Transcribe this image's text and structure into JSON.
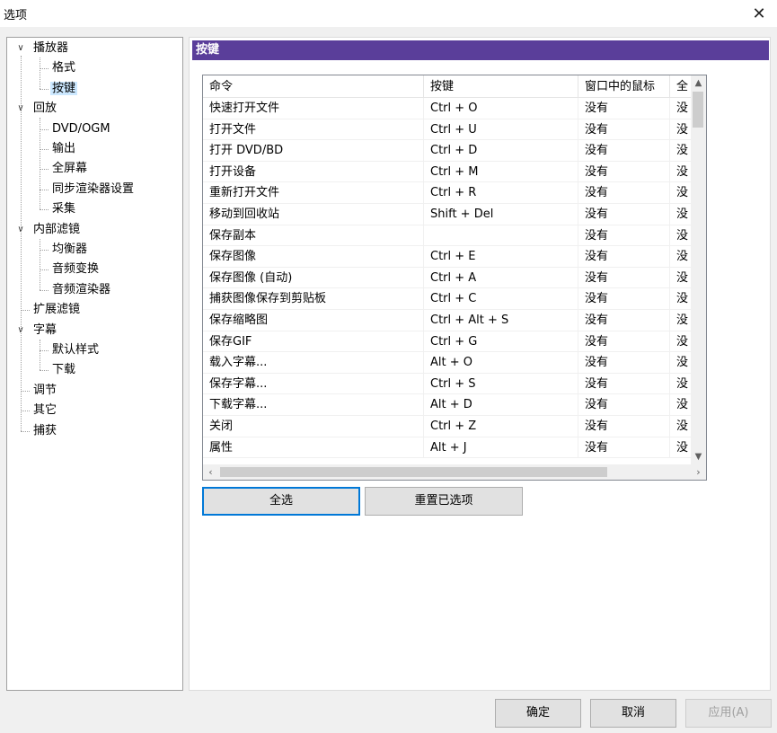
{
  "window": {
    "title": "选项",
    "close_glyph": "✕"
  },
  "tree": {
    "items": [
      {
        "label": "播放器",
        "level": 0,
        "expanded": true
      },
      {
        "label": "格式",
        "level": 1
      },
      {
        "label": "按键",
        "level": 1,
        "selected": true
      },
      {
        "label": "回放",
        "level": 0,
        "expanded": true
      },
      {
        "label": "DVD/OGM",
        "level": 1
      },
      {
        "label": "输出",
        "level": 1
      },
      {
        "label": "全屏幕",
        "level": 1
      },
      {
        "label": "同步渲染器设置",
        "level": 1
      },
      {
        "label": "采集",
        "level": 1
      },
      {
        "label": "内部滤镜",
        "level": 0,
        "expanded": true
      },
      {
        "label": "均衡器",
        "level": 1
      },
      {
        "label": "音频变换",
        "level": 1
      },
      {
        "label": "音频渲染器",
        "level": 1
      },
      {
        "label": "扩展滤镜",
        "level": 0
      },
      {
        "label": "字幕",
        "level": 0,
        "expanded": true
      },
      {
        "label": "默认样式",
        "level": 1
      },
      {
        "label": "下载",
        "level": 1
      },
      {
        "label": "调节",
        "level": 0
      },
      {
        "label": "其它",
        "level": 0
      },
      {
        "label": "捕获",
        "level": 0
      }
    ]
  },
  "panel": {
    "header": "按键",
    "columns": [
      "命令",
      "按键",
      "窗口中的鼠标",
      "全"
    ],
    "rows": [
      [
        "快速打开文件",
        "Ctrl + O",
        "没有",
        "没"
      ],
      [
        "打开文件",
        "Ctrl + U",
        "没有",
        "没"
      ],
      [
        "打开 DVD/BD",
        "Ctrl + D",
        "没有",
        "没"
      ],
      [
        "打开设备",
        "Ctrl + M",
        "没有",
        "没"
      ],
      [
        "重新打开文件",
        "Ctrl + R",
        "没有",
        "没"
      ],
      [
        "移动到回收站",
        "Shift + Del",
        "没有",
        "没"
      ],
      [
        "保存副本",
        "",
        "没有",
        "没"
      ],
      [
        "保存图像",
        "Ctrl + E",
        "没有",
        "没"
      ],
      [
        "保存图像 (自动)",
        "Ctrl + A",
        "没有",
        "没"
      ],
      [
        "捕获图像保存到剪贴板",
        "Ctrl + C",
        "没有",
        "没"
      ],
      [
        "保存缩略图",
        "Ctrl + Alt + S",
        "没有",
        "没"
      ],
      [
        "保存GIF",
        "Ctrl + G",
        "没有",
        "没"
      ],
      [
        "载入字幕...",
        "Alt + O",
        "没有",
        "没"
      ],
      [
        "保存字幕...",
        "Ctrl + S",
        "没有",
        "没"
      ],
      [
        "下载字幕...",
        "Alt + D",
        "没有",
        "没"
      ],
      [
        "关闭",
        "Ctrl + Z",
        "没有",
        "没"
      ],
      [
        "属性",
        "Alt + J",
        "没有",
        "没"
      ]
    ],
    "select_all": "全选",
    "reset_selected": "重置已选项"
  },
  "footer": {
    "ok": "确定",
    "cancel": "取消",
    "apply": "应用(A)"
  }
}
